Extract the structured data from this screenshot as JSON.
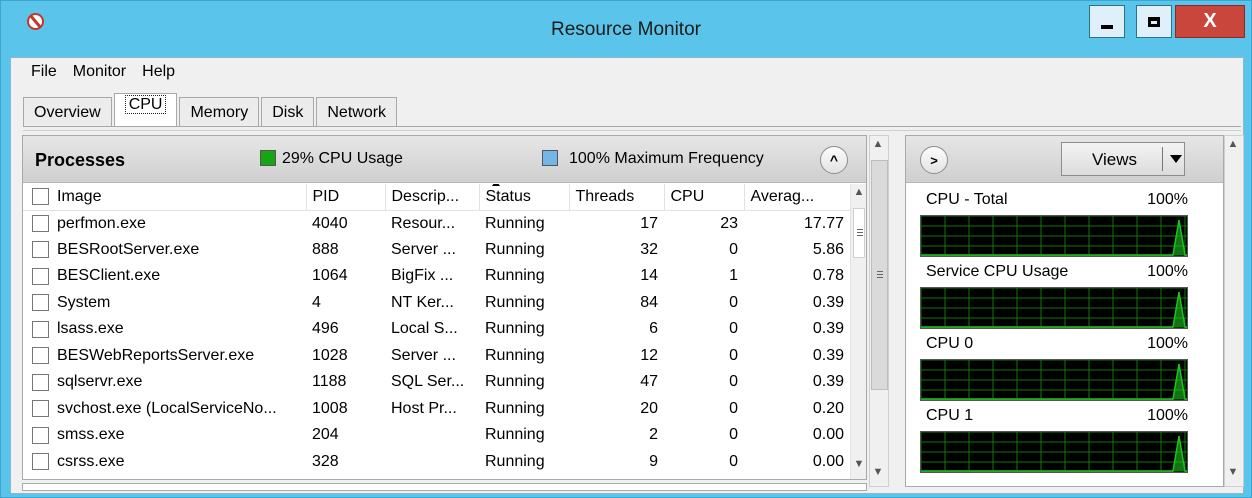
{
  "window": {
    "title": "Resource Monitor",
    "close_glyph": "X"
  },
  "menu": [
    "File",
    "Monitor",
    "Help"
  ],
  "tabs": [
    "Overview",
    "CPU",
    "Memory",
    "Disk",
    "Network"
  ],
  "active_tab": "CPU",
  "processes": {
    "title": "Processes",
    "cpu_usage_label": "29% CPU Usage",
    "max_freq_label": "100% Maximum Frequency",
    "cpu_usage_percent": 29,
    "columns": [
      "Image",
      "PID",
      "Descrip...",
      "Status",
      "Threads",
      "CPU",
      "Averag..."
    ],
    "rows": [
      [
        "perfmon.exe",
        "4040",
        "Resour...",
        "Running",
        "17",
        "23",
        "17.77"
      ],
      [
        "BESRootServer.exe",
        "888",
        "Server ...",
        "Running",
        "32",
        "0",
        "5.86"
      ],
      [
        "BESClient.exe",
        "1064",
        "BigFix ...",
        "Running",
        "14",
        "1",
        "0.78"
      ],
      [
        "System",
        "4",
        "NT Ker...",
        "Running",
        "84",
        "0",
        "0.39"
      ],
      [
        "lsass.exe",
        "496",
        "Local S...",
        "Running",
        "6",
        "0",
        "0.39"
      ],
      [
        "BESWebReportsServer.exe",
        "1028",
        "Server ...",
        "Running",
        "12",
        "0",
        "0.39"
      ],
      [
        "sqlservr.exe",
        "1188",
        "SQL Ser...",
        "Running",
        "47",
        "0",
        "0.39"
      ],
      [
        "svchost.exe (LocalServiceNo...",
        "1008",
        "Host Pr...",
        "Running",
        "20",
        "0",
        "0.20"
      ],
      [
        "smss.exe",
        "204",
        "",
        "Running",
        "2",
        "0",
        "0.00"
      ],
      [
        "csrss.exe",
        "328",
        "",
        "Running",
        "9",
        "0",
        "0.00"
      ]
    ]
  },
  "right_panel": {
    "views_label": "Views",
    "graphs": [
      {
        "title": "CPU - Total",
        "value": "100%"
      },
      {
        "title": "Service CPU Usage",
        "value": "100%"
      },
      {
        "title": "CPU 0",
        "value": "100%"
      },
      {
        "title": "CPU 1",
        "value": "100%"
      }
    ]
  },
  "colors": {
    "title_bar": "#5bc4ea",
    "cpu_usage_legend": "#15a515",
    "max_freq_legend": "#73b6e8",
    "graph_line": "#1ec21e",
    "graph_grid": "#0a7a0a"
  }
}
